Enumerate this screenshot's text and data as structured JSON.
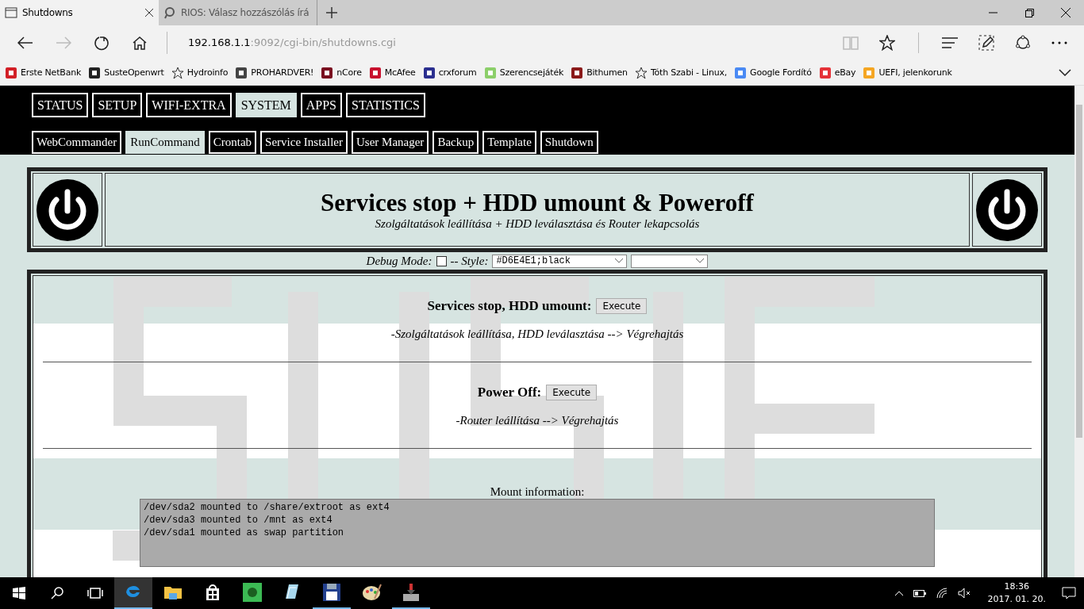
{
  "browser": {
    "tabs": [
      {
        "title": "Shutdowns",
        "selected": true
      },
      {
        "title": "RIOS: Válasz hozzászólás írá",
        "selected": false
      }
    ],
    "address": {
      "host": "192.168.1.1",
      "path": ":9092/cgi-bin/shutdowns.cgi"
    },
    "favorites": [
      {
        "label": "Erste NetBank",
        "kind": "site"
      },
      {
        "label": "SusteOpenwrt",
        "kind": "site"
      },
      {
        "label": "Hydroinfo",
        "kind": "star"
      },
      {
        "label": "PROHARDVER!",
        "kind": "site"
      },
      {
        "label": "nCore",
        "kind": "site"
      },
      {
        "label": "McAfee",
        "kind": "site"
      },
      {
        "label": "crxforum",
        "kind": "site"
      },
      {
        "label": "Szerencsejáték",
        "kind": "site"
      },
      {
        "label": "Bithumen",
        "kind": "site"
      },
      {
        "label": "Tóth Szabi - Linux,",
        "kind": "star"
      },
      {
        "label": "Google Fordító",
        "kind": "site"
      },
      {
        "label": "eBay",
        "kind": "site"
      },
      {
        "label": "UEFI, jelenkorunk",
        "kind": "site"
      }
    ]
  },
  "page": {
    "top_menu": [
      {
        "label": "STATUS",
        "selected": false
      },
      {
        "label": "SETUP",
        "selected": false
      },
      {
        "label": "WIFI-EXTRA",
        "selected": false
      },
      {
        "label": "SYSTEM",
        "selected": true
      },
      {
        "label": "APPS",
        "selected": false
      },
      {
        "label": "STATISTICS",
        "selected": false
      }
    ],
    "sub_menu": [
      {
        "label": "WebCommander",
        "selected": false
      },
      {
        "label": "RunCommand",
        "selected": true
      },
      {
        "label": "Crontab",
        "selected": false
      },
      {
        "label": "Service Installer",
        "selected": false
      },
      {
        "label": "User Manager",
        "selected": false
      },
      {
        "label": "Backup",
        "selected": false
      },
      {
        "label": "Template",
        "selected": false
      },
      {
        "label": "Shutdown",
        "selected": false
      }
    ],
    "header": {
      "title": "Services stop + HDD umount & Poweroff",
      "subtitle": "Szolgáltatások leállítása + HDD leválasztása és Router lekapcsolás"
    },
    "debug": {
      "label": "Debug Mode:",
      "checked": false,
      "style_label": "-- Style:",
      "style_value": "#D6E4E1;black"
    },
    "actions": [
      {
        "label": "Services stop, HDD umount:",
        "button": "Execute",
        "description": "-Szolgáltatások leállítása, HDD leválasztása --> Végrehajtás"
      },
      {
        "label": "Power Off:",
        "button": "Execute",
        "description": "-Router leállítása --> Végrehajtás"
      }
    ],
    "mount": {
      "label": "Mount information:",
      "lines": [
        "/dev/sda2 mounted to /share/extroot as ext4",
        "/dev/sda3 mounted to /mnt as ext4",
        "/dev/sda1 mounted as swap partition"
      ]
    }
  },
  "taskbar": {
    "apps": [
      {
        "active": true,
        "running": true
      },
      {
        "active": false,
        "running": false
      },
      {
        "active": false,
        "running": false
      },
      {
        "active": false,
        "running": false
      },
      {
        "active": false,
        "running": false
      },
      {
        "active": false,
        "running": true
      },
      {
        "active": false,
        "running": false
      },
      {
        "active": false,
        "running": true
      }
    ],
    "clock": {
      "time": "18:36",
      "date": "2017. 01. 20."
    }
  }
}
